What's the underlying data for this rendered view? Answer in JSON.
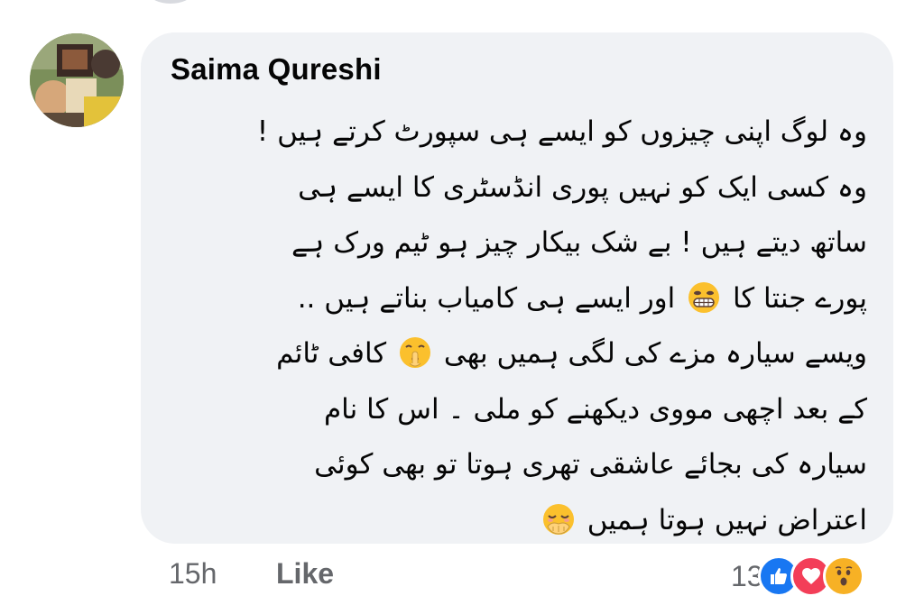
{
  "comment": {
    "author": "Saima Qureshi",
    "lines": [
      "وہ لوگ اپنی چیزوں کو ایسے ہی سپورٹ کرتے ہیں !",
      "وہ کسی ایک کو نہیں پوری انڈسٹری کا ایسے ہی",
      "ساتھ دیتے ہیں ! بے شک بیکار چیز ہو ٹیم ورک ہے",
      "پورے جنتا کا",
      "اور ایسے ہی کامیاب بناتے ہیں ..",
      "ویسے سیارہ مزے کی لگی ہمیں بھی",
      "کافی ٹائم",
      "کے بعد اچھی مووی دیکھنے کو ملی ۔ اس کا نام",
      "سیارہ کی بجائے عاشقی تھری ہوتا تو بھی کوئی",
      "اعتراض نہیں ہوتا ہمیں"
    ],
    "emojis": {
      "grin": "grinning-face-emoji",
      "shush": "shushing-face-emoji",
      "giggle": "hand-over-mouth-emoji"
    }
  },
  "footer": {
    "time": "15h",
    "like_label": "Like",
    "reaction_count": "13",
    "reactions": [
      "like-reaction-icon",
      "love-reaction-icon",
      "wow-reaction-icon"
    ]
  },
  "colors": {
    "bubble": "#f0f2f5",
    "meta_text": "#65676b",
    "like_blue": "#1877f2",
    "love_red": "#f33e58",
    "wow_yellow": "#f7b125"
  }
}
